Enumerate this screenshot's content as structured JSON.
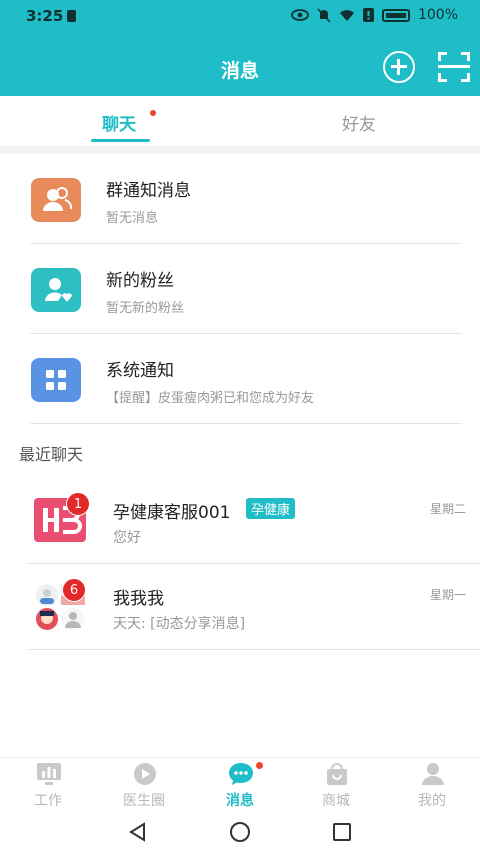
{
  "status_bar": {
    "time": "3:25",
    "battery": "100%"
  },
  "header": {
    "title": "消息"
  },
  "tabs": [
    {
      "label": "聊天",
      "active": true,
      "has_dot": true
    },
    {
      "label": "好友",
      "active": false
    }
  ],
  "notifications": [
    {
      "title": "群通知消息",
      "subtitle": "暂无消息",
      "color": "#e98a5b",
      "icon": "group-users-icon"
    },
    {
      "title": "新的粉丝",
      "subtitle": "暂无新的粉丝",
      "color": "#2dbfc3",
      "icon": "follower-heart-icon"
    },
    {
      "title": "系统通知",
      "subtitle": "【提醒】皮蛋瘦肉粥已和您成为好友",
      "color": "#5b93e4",
      "icon": "grid-apps-icon"
    }
  ],
  "recent_label": "最近聊天",
  "chats": [
    {
      "name": "孕健康客服001",
      "tag": "孕健康",
      "preview": "您好",
      "time": "星期二",
      "badge": "1",
      "avatar": "hb-logo-avatar"
    },
    {
      "name": "我我我",
      "preview": "天天: [动态分享消息]",
      "time": "星期一",
      "badge": "6",
      "avatar": "group-avatar"
    }
  ],
  "bottom_nav": [
    {
      "label": "工作",
      "icon": "work-chart-icon",
      "active": false
    },
    {
      "label": "医生圈",
      "icon": "doctor-circle-icon",
      "active": false
    },
    {
      "label": "消息",
      "icon": "message-bubble-icon",
      "active": true,
      "has_dot": true
    },
    {
      "label": "商城",
      "icon": "shop-bag-icon",
      "active": false
    },
    {
      "label": "我的",
      "icon": "profile-icon",
      "active": false
    }
  ],
  "colors": {
    "brand": "#1ebdc7",
    "badge": "#e22a2a",
    "dot": "#e8442f"
  }
}
